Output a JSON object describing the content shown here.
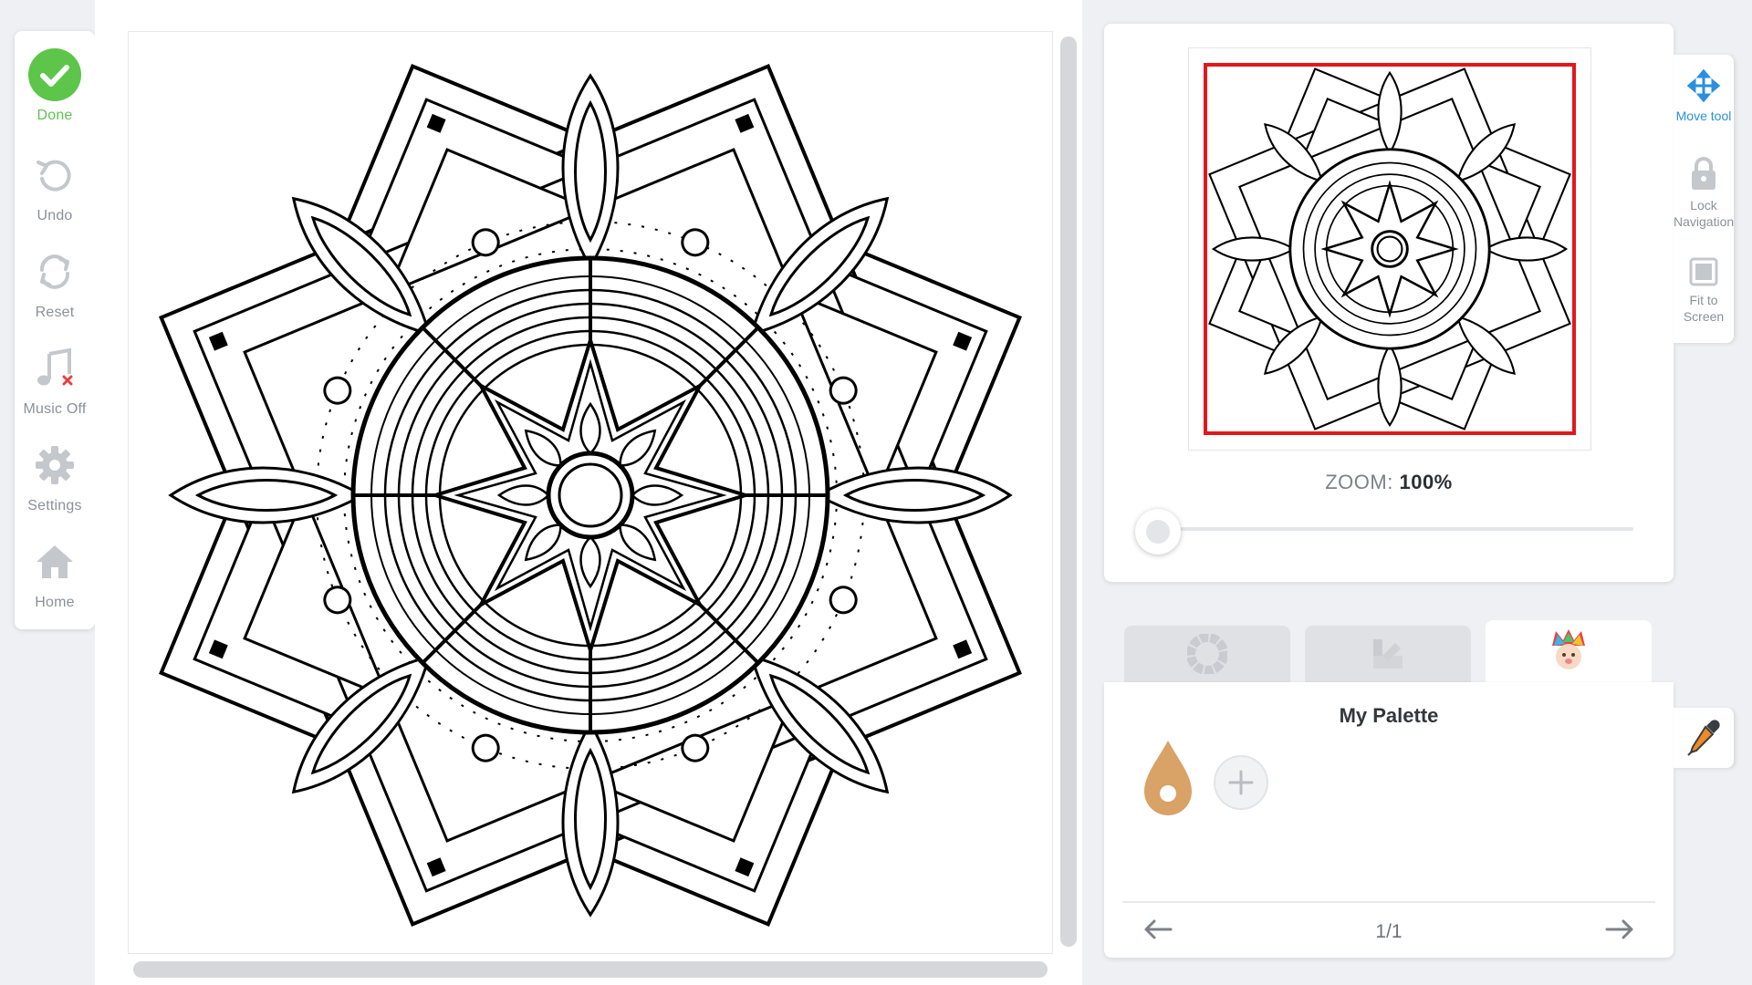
{
  "toolbar": {
    "done": "Done",
    "undo": "Undo",
    "reset": "Reset",
    "music": "Music Off",
    "settings": "Settings",
    "home": "Home"
  },
  "navigator": {
    "zoom_prefix": "ZOOM:",
    "zoom_value": "100%",
    "zoom_level": 0
  },
  "nav_tools": {
    "move": "Move tool",
    "lock": "Lock Navigation",
    "fit": "Fit to Screen"
  },
  "tabs": [
    {
      "name": "color-wheel",
      "active": false
    },
    {
      "name": "gradients",
      "active": false
    },
    {
      "name": "my-palette",
      "active": true
    }
  ],
  "palette": {
    "title": "My Palette",
    "swatches": [
      "#d9a266"
    ],
    "page": "1/1"
  },
  "colors": {
    "accent_green": "#5cc54a",
    "accent_blue": "#2a8fe0",
    "viewport_red": "#e3171b"
  }
}
